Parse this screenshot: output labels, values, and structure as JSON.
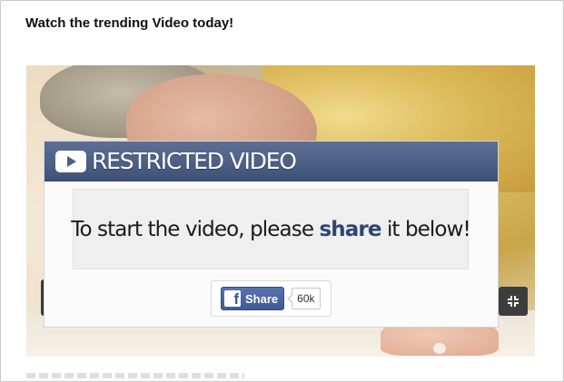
{
  "page": {
    "title": "Watch the trending Video today!"
  },
  "overlay": {
    "header_title": "RESTRICTED VIDEO",
    "header_icon": "play-icon",
    "message_prefix": "To start the video, please ",
    "message_highlight": "share",
    "message_suffix": " it below!"
  },
  "share": {
    "logo_letter": "f",
    "button_label": "Share",
    "count": "60k",
    "icon": "facebook-icon"
  },
  "video": {
    "control_icon": "fullscreen-exit-icon"
  },
  "colors": {
    "header_bg": "#4b5e84",
    "highlight": "#2f4574",
    "facebook": "#3f5b9a"
  }
}
